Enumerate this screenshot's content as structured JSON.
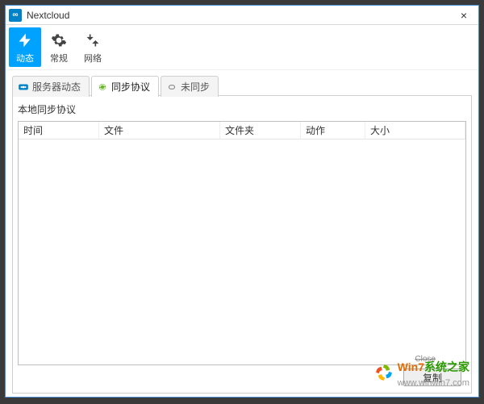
{
  "window": {
    "title": "Nextcloud"
  },
  "toolbar": {
    "items": [
      {
        "label": "动态",
        "icon": "bolt-icon",
        "active": true
      },
      {
        "label": "常规",
        "icon": "gear-icon",
        "active": false
      },
      {
        "label": "网络",
        "icon": "network-icon",
        "active": false
      }
    ]
  },
  "tabs": {
    "items": [
      {
        "label": "服务器动态",
        "icon": "cloud-icon",
        "active": false
      },
      {
        "label": "同步协议",
        "icon": "sync-icon",
        "active": true
      },
      {
        "label": "未同步",
        "icon": "link-icon",
        "active": false
      }
    ]
  },
  "panel": {
    "section_label": "本地同步协议",
    "columns": [
      "时间",
      "文件",
      "文件夹",
      "动作",
      "大小"
    ],
    "rows": []
  },
  "buttons": {
    "copy": "复制",
    "close_small": "Close"
  },
  "watermark": {
    "line1": "Win7",
    "line2": "系统之家",
    "site": "www.winwin7.com"
  },
  "colors": {
    "accent": "#00a2ff",
    "brand": "#0082c9",
    "border": "#cfcfcf"
  }
}
